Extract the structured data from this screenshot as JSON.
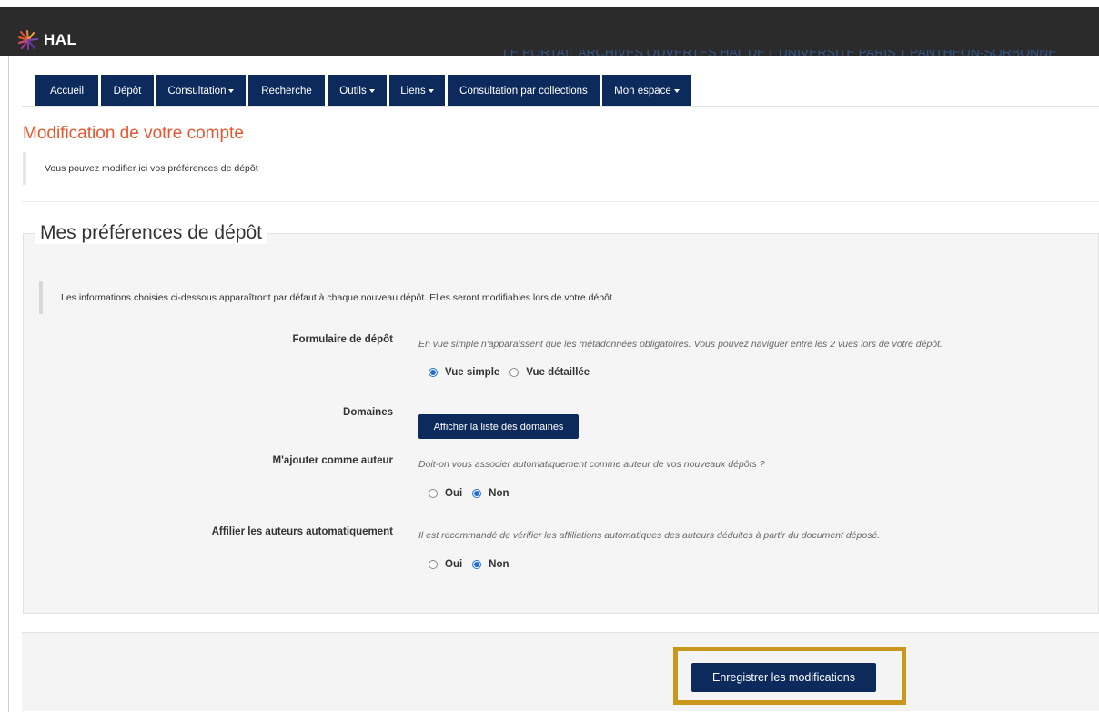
{
  "header": {
    "logo_text": "HAL",
    "portal_title": "LE PORTAIL ARCHIVES OUVERTES HAL DE L'UNIVERSITÉ PARIS 1 PANTHÉON-SORBONNE"
  },
  "nav": {
    "items": [
      {
        "label": "Accueil",
        "dropdown": false
      },
      {
        "label": "Dépôt",
        "dropdown": false
      },
      {
        "label": "Consultation",
        "dropdown": true
      },
      {
        "label": "Recherche",
        "dropdown": false
      },
      {
        "label": "Outils",
        "dropdown": true
      },
      {
        "label": "Liens",
        "dropdown": true
      },
      {
        "label": "Consultation par collections",
        "dropdown": false
      },
      {
        "label": "Mon espace",
        "dropdown": true
      }
    ]
  },
  "page": {
    "title": "Modification de votre compte",
    "intro": "Vous pouvez modifier ici vos préférences de dépôt"
  },
  "prefs": {
    "legend": "Mes préférences de dépôt",
    "info": "Les informations choisies ci-dessous apparaîtront par défaut à chaque nouveau dépôt. Elles seront modifiables lors de votre dépôt.",
    "formulaire": {
      "label": "Formulaire de dépôt",
      "help": "En vue simple n'apparaissent que les métadonnées obligatoires. Vous pouvez naviguer entre les 2 vues lors de votre dépôt.",
      "options": [
        "Vue simple",
        "Vue détaillée"
      ],
      "selected": "Vue simple"
    },
    "domaines": {
      "label": "Domaines",
      "button": "Afficher la liste des domaines"
    },
    "ajouter_auteur": {
      "label": "M'ajouter comme auteur",
      "help": "Doit-on vous associer automatiquement comme auteur de vos nouveaux dépôts ?",
      "options": [
        "Oui",
        "Non"
      ],
      "selected": "Non"
    },
    "affilier": {
      "label": "Affilier les auteurs automatiquement",
      "help": "Il est recommandé de vérifier les affiliations automatiques des auteurs déduites à partir du document déposé.",
      "options": [
        "Oui",
        "Non"
      ],
      "selected": "Non"
    }
  },
  "footer": {
    "save_button": "Enregistrer les modifications",
    "highlight_color": "#c9971c"
  },
  "colors": {
    "topbar": "#2b2b2b",
    "nav": "#0c2b5c",
    "title": "#e4572e",
    "radio_selected": "#1f6fd1"
  }
}
